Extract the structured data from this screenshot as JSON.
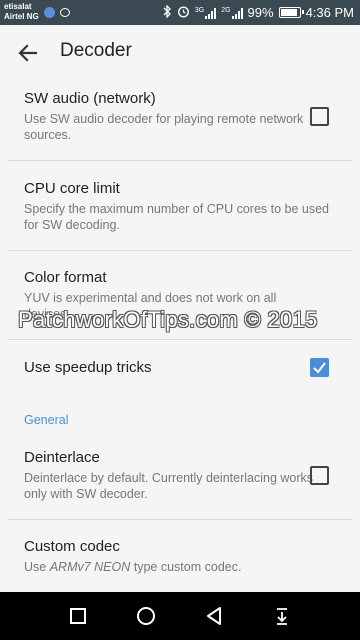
{
  "status_bar": {
    "carrier_top": "etisalat",
    "carrier_bottom": "Airtel NG",
    "network_1": "3G",
    "network_2": "2G",
    "battery": "99%",
    "battery_level": 0.99,
    "time": "4:36 PM"
  },
  "app_bar": {
    "title": "Decoder"
  },
  "settings": [
    {
      "title": "SW audio (network)",
      "summary": "Use SW audio decoder for playing remote network sources.",
      "has_checkbox": true,
      "checked": false
    },
    {
      "title": "CPU core limit",
      "summary": "Specify the maximum number of CPU cores to be used for SW decoding.",
      "has_checkbox": false
    },
    {
      "title": "Color format",
      "summary": "YUV is experimental and does not work on all devices.",
      "has_checkbox": false
    },
    {
      "title": "Use speedup tricks",
      "summary": "",
      "has_checkbox": true,
      "checked": true
    }
  ],
  "section_general": "General",
  "settings_general": [
    {
      "title": "Deinterlace",
      "summary": "Deinterlace by default. Currently deinterlacing works only with SW decoder.",
      "has_checkbox": true,
      "checked": false
    },
    {
      "title": "Custom codec",
      "summary_prefix": "Use ",
      "summary_emph": "ARMv7 NEON",
      "summary_suffix": " type custom codec.",
      "has_checkbox": false
    }
  ],
  "watermark": "PatchworkOfTips.com © 2015",
  "colors": {
    "status_bar": "#3b4a52",
    "accent": "#4a8ed6",
    "background": "#f5f5f5"
  }
}
